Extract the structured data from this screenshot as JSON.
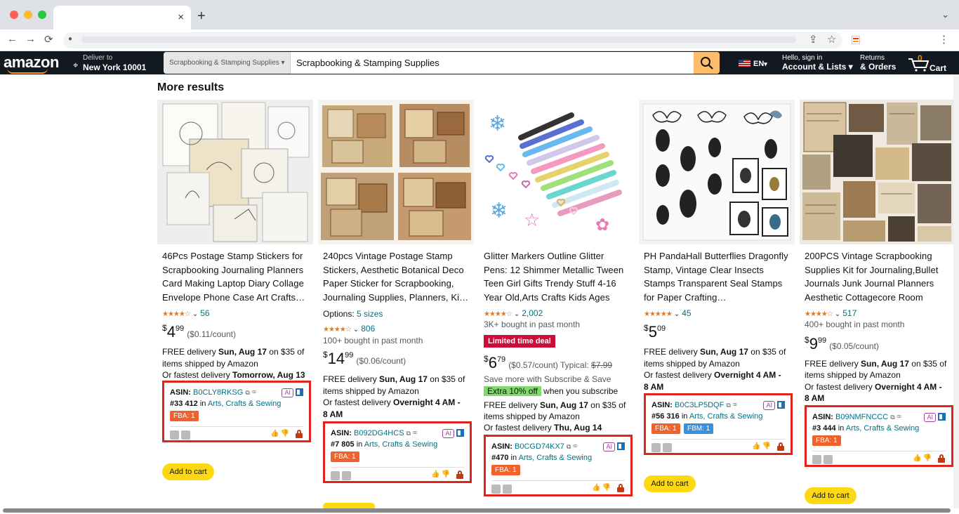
{
  "browser": {
    "url": "",
    "tab_close": "×",
    "new_tab": "+",
    "tab_menu": "⌄",
    "back": "←",
    "forward": "→",
    "reload": "⟳",
    "share": "⇪",
    "bookmark": "☆",
    "menu": "⋮"
  },
  "header": {
    "logo": "amazon",
    "deliver_to": "Deliver to",
    "location": "New York 10001",
    "search_category": "Scrapbooking & Stamping Supplies ▾",
    "search_query": "Scrapbooking & Stamping Supplies",
    "language": "EN",
    "lang_caret": "▾",
    "hello": "Hello, sign in",
    "account": "Account & Lists ▾",
    "returns": "Returns",
    "orders": "& Orders",
    "cart_count": "0",
    "cart_label": "Cart"
  },
  "section_title": "More results",
  "products": [
    {
      "title": "46Pcs Postage Stamp Stickers for Scrapbooking Journaling Planners Card Making Laptop Diary Collage Envelope Phone Case Art Crafts…",
      "stars": "★★★★☆",
      "reviews": "56",
      "price_whole": "4",
      "price_frac": "99",
      "unit_price": "($0.11/count)",
      "delivery_a": "FREE delivery ",
      "delivery_date": "Sun, Aug 17",
      "delivery_b": " on $35 of",
      "delivery_c": "items shipped by Amazon",
      "fast_a": "Or fastest delivery ",
      "fast_b": "Tomorrow, Aug 13",
      "asin": "B0CLY8RKSG",
      "rank": "#33 412",
      "category": "Arts, Crafts & Sewing",
      "fba": "FBA: 1",
      "add_to_cart": "Add to cart"
    },
    {
      "title": "240pcs Vintage Postage Stamp Stickers, Aesthetic Botanical Deco Paper Sticker for Scrapbooking, Journaling Supplies, Planners, Ki…",
      "options_label": "Options: ",
      "options_value": "5 sizes",
      "stars": "★★★★☆",
      "reviews": "806",
      "bought": "100+ bought in past month",
      "price_whole": "14",
      "price_frac": "99",
      "unit_price": "($0.06/count)",
      "delivery_a": "FREE delivery ",
      "delivery_date": "Sun, Aug 17",
      "delivery_b": " on $35 of",
      "delivery_c": "items shipped by Amazon",
      "fast_a": "Or fastest delivery ",
      "fast_b": "Overnight 4 AM -",
      "fast_c": "8 AM",
      "asin": "B092DG4HCS",
      "rank": "#7 805",
      "category": "Arts, Crafts & Sewing",
      "fba": "FBA: 1"
    },
    {
      "title": "Glitter Markers Outline Glitter Pens: 12 Shimmer Metallic Tween Teen Girl Gifts Trendy Stuff 4-16 Year Old,Arts Crafts Kids Ages 8-…",
      "stars": "★★★★☆",
      "reviews": "2,002",
      "bought": "3K+ bought in past month",
      "deal": "Limited time deal",
      "price_whole": "6",
      "price_frac": "79",
      "unit_price": "($0.57/count) Typical: ",
      "typical": "$7.99",
      "subscribe": "Save more with Subscribe & Save",
      "extra_off": "Extra 10% off",
      "when_sub": " when you subscribe",
      "delivery_a": "FREE delivery ",
      "delivery_date": "Sun, Aug 17",
      "delivery_b": " on $35 of",
      "delivery_c": "items shipped by Amazon",
      "fast_a": "Or fastest delivery ",
      "fast_b": "Thu, Aug 14",
      "asin": "B0CGD74KX7",
      "rank": "#470",
      "category": "Arts, Crafts & Sewing",
      "fba": "FBA: 1"
    },
    {
      "title": "PH PandaHall Butterflies Dragonfly Stamp, Vintage Clear Insects Stamps Transparent Seal Stamps for Paper Crafting…",
      "stars": "★★★★★",
      "reviews": "45",
      "price_whole": "5",
      "price_frac": "09",
      "delivery_a": "FREE delivery ",
      "delivery_date": "Sun, Aug 17",
      "delivery_b": " on $35 of",
      "delivery_c": "items shipped by Amazon",
      "fast_a": "Or fastest delivery ",
      "fast_b": "Overnight 4 AM -",
      "fast_c": "8 AM",
      "asin": "B0C3LP5DQF",
      "rank": "#56 316",
      "category": "Arts, Crafts & Sewing",
      "fba": "FBA: 1",
      "fbm": "FBM: 1",
      "add_to_cart": "Add to cart"
    },
    {
      "title": "200PCS Vintage Scrapbooking Supplies Kit for Journaling,Bullet Journals Junk Journal Planners Aesthetic Cottagecore Room Dec…",
      "stars": "★★★★☆",
      "reviews": "517",
      "bought": "400+ bought in past month",
      "price_whole": "9",
      "price_frac": "99",
      "unit_price": "($0.05/count)",
      "delivery_a": "FREE delivery ",
      "delivery_date": "Sun, Aug 17",
      "delivery_b": " on $35 of",
      "delivery_c": "items shipped by Amazon",
      "fast_a": "Or fastest delivery ",
      "fast_b": "Overnight 4 AM -",
      "fast_c": "8 AM",
      "asin": "B09NMFNCCC",
      "rank": "#3 444",
      "category": "Arts, Crafts & Sewing",
      "fba": "FBA: 1",
      "add_to_cart": "Add to cart"
    }
  ],
  "ext": {
    "asin_label": "ASIN: ",
    "in": " in ",
    "ai": "AI",
    "icons": "⧉ ⚭",
    "thumbs": "👍👎"
  },
  "colors": {
    "amazon_nav": "#131921",
    "search_button": "#febd69",
    "add_to_cart": "#ffd814",
    "highlight_border": "#e0241b",
    "fba_badge": "#f0612c",
    "fbm_badge": "#3b8fe0",
    "link": "#007185"
  }
}
